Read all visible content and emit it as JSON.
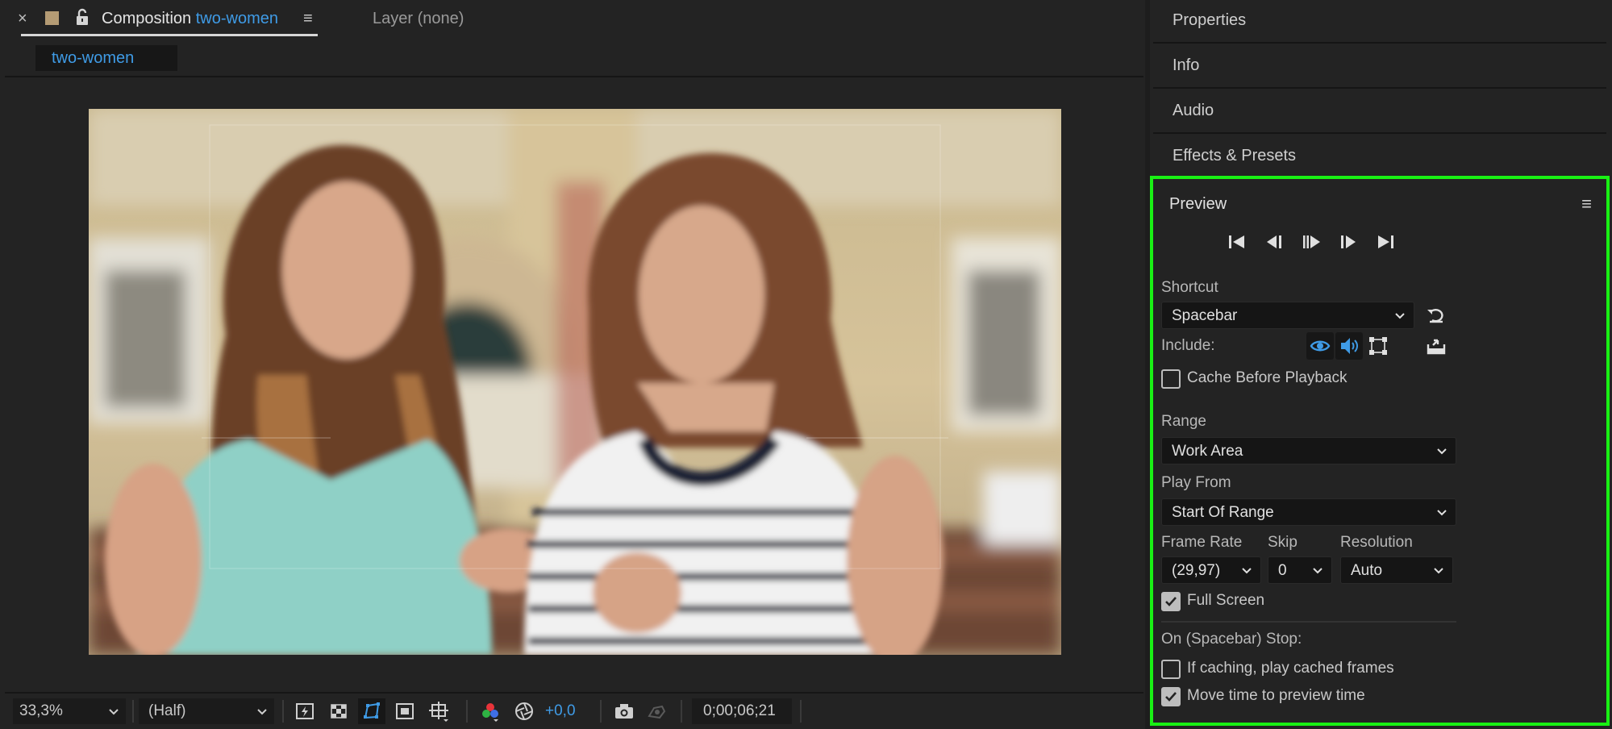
{
  "composition_panel": {
    "tab": {
      "close": "×",
      "prefix": "Composition",
      "name": "two-women",
      "menu": "≡"
    },
    "layer_tab": "Layer (none)",
    "comp_chip": "two-women",
    "footer": {
      "zoom": "33,3%",
      "resolution": "(Half)",
      "exposure": "+0,0",
      "timecode": "0;00;06;21"
    }
  },
  "right_panels": {
    "properties": "Properties",
    "info": "Info",
    "audio": "Audio",
    "effects": "Effects & Presets"
  },
  "preview": {
    "title": "Preview",
    "menu": "≡",
    "shortcut_label": "Shortcut",
    "shortcut_value": "Spacebar",
    "include_label": "Include:",
    "cache_before_playback": {
      "label": "Cache Before Playback",
      "checked": false
    },
    "range_label": "Range",
    "range_value": "Work Area",
    "play_from_label": "Play From",
    "play_from_value": "Start Of Range",
    "frame_rate_label": "Frame Rate",
    "frame_rate_value": "(29,97)",
    "skip_label": "Skip",
    "skip_value": "0",
    "resolution_label": "Resolution",
    "resolution_value": "Auto",
    "full_screen": {
      "label": "Full Screen",
      "checked": true
    },
    "on_stop_label": "On (Spacebar) Stop:",
    "if_caching": {
      "label": "If caching, play cached frames",
      "checked": false
    },
    "move_time": {
      "label": "Move time to preview time",
      "checked": true
    }
  },
  "colors": {
    "accent_blue": "#3f9be6",
    "highlight_green": "#19f014",
    "panel_bg": "#232323"
  }
}
